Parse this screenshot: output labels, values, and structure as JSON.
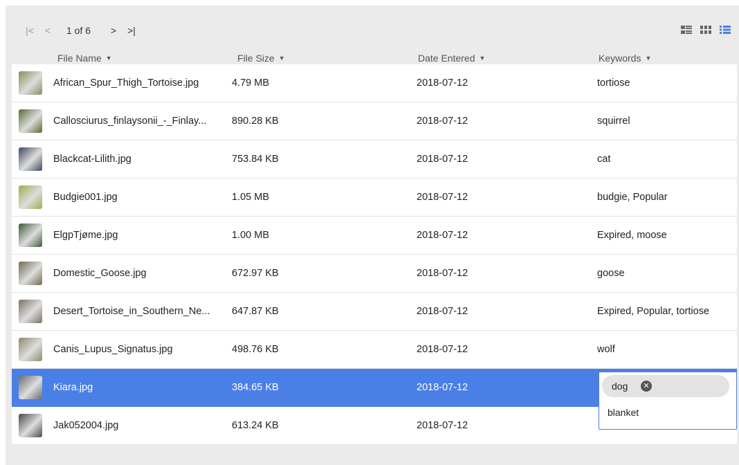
{
  "pager": {
    "first_icon": "first-page-icon",
    "prev_icon": "prev-page-icon",
    "first_glyph": "|<",
    "prev_glyph": "<",
    "page_text": "1 of 6",
    "next_glyph": ">",
    "last_glyph": ">|",
    "next_icon": "next-page-icon",
    "last_icon": "last-page-icon"
  },
  "views": [
    "detail-view-icon",
    "grid-view-icon",
    "list-view-icon"
  ],
  "colors": {
    "selected": "#4a7fe6",
    "background": "#ebebeb",
    "row": "#ffffff"
  },
  "columns": {
    "name": "File Name",
    "size": "File Size",
    "date": "Date Entered",
    "keywords": "Keywords"
  },
  "rows": [
    {
      "name": "African_Spur_Thigh_Tortoise.jpg",
      "size": "4.79 MB",
      "date": "2018-07-12",
      "keywords": "tortiose",
      "thumb": "#8a8e5a"
    },
    {
      "name": "Callosciurus_finlaysonii_-_Finlay...",
      "size": "890.28 KB",
      "date": "2018-07-12",
      "keywords": "squirrel",
      "thumb": "#5a6a2e"
    },
    {
      "name": "Blackcat-Lilith.jpg",
      "size": "753.84 KB",
      "date": "2018-07-12",
      "keywords": "cat",
      "thumb": "#3a4a5a"
    },
    {
      "name": "Budgie001.jpg",
      "size": "1.05 MB",
      "date": "2018-07-12",
      "keywords": "budgie, Popular",
      "thumb": "#9ab048"
    },
    {
      "name": "ElgpTjøme.jpg",
      "size": "1.00 MB",
      "date": "2018-07-12",
      "keywords": "Expired, moose",
      "thumb": "#3e5a38"
    },
    {
      "name": "Domestic_Goose.jpg",
      "size": "672.97 KB",
      "date": "2018-07-12",
      "keywords": "goose",
      "thumb": "#6e6a52"
    },
    {
      "name": "Desert_Tortoise_in_Southern_Ne...",
      "size": "647.87 KB",
      "date": "2018-07-12",
      "keywords": "Expired, Popular, tortiose",
      "thumb": "#7a7060"
    },
    {
      "name": "Canis_Lupus_Signatus.jpg",
      "size": "498.76 KB",
      "date": "2018-07-12",
      "keywords": "wolf",
      "thumb": "#8c8a6e"
    },
    {
      "name": "Kiara.jpg",
      "size": "384.65 KB",
      "date": "2018-07-12",
      "keywords": "",
      "thumb": "#6a6a70",
      "selected": true
    },
    {
      "name": "Jak052004.jpg",
      "size": "613.24 KB",
      "date": "2018-07-12",
      "keywords": "",
      "thumb": "#4a4a48"
    }
  ],
  "editor": {
    "chip_label": "dog",
    "chip_remove_icon": "remove-chip-icon",
    "chip_remove_glyph": "✕",
    "input_value": "blanket"
  }
}
